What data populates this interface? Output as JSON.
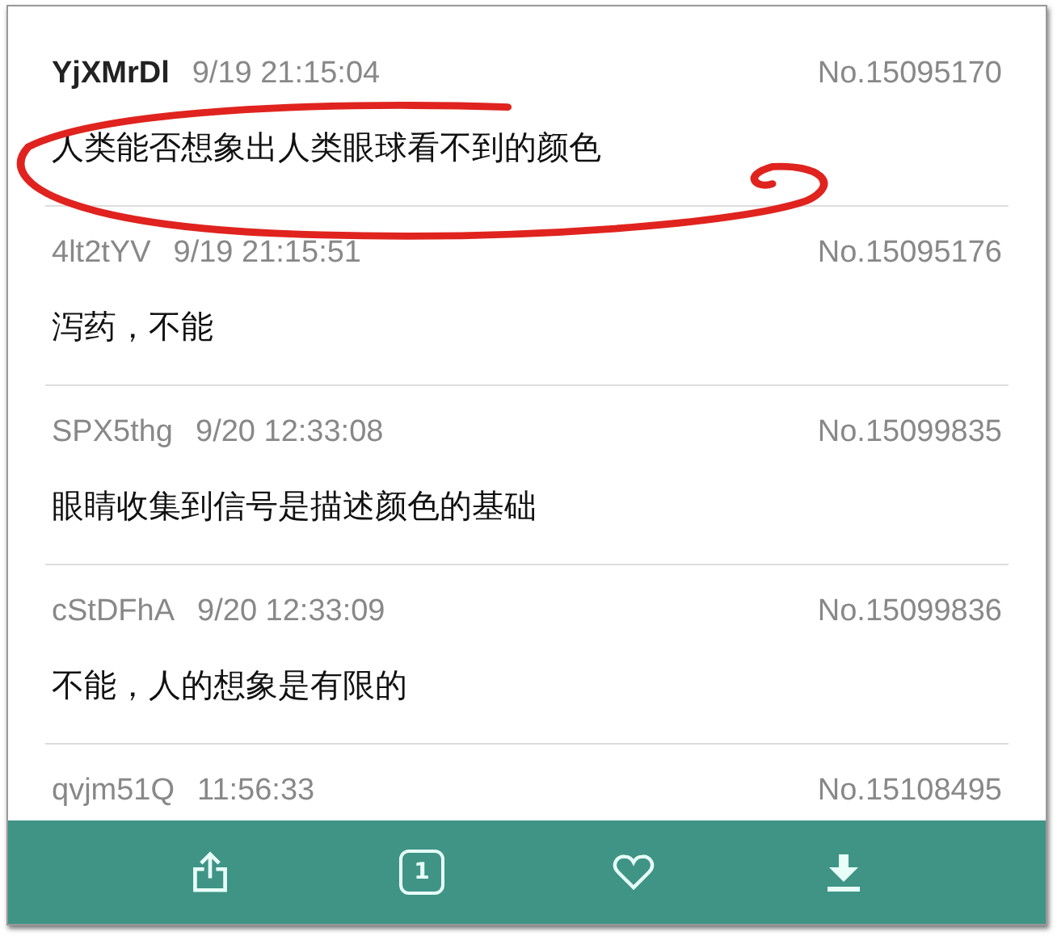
{
  "posts": [
    {
      "kind": "original",
      "user": "YjXMrDl",
      "time": "9/19 21:15:04",
      "number": "No.15095170",
      "text": "人类能否想象出人类眼球看不到的颜色",
      "circled": true
    },
    {
      "kind": "reply",
      "user": "4lt2tYV",
      "time": "9/19 21:15:51",
      "number": "No.15095176",
      "text": "泻药，不能",
      "circled": false
    },
    {
      "kind": "reply",
      "user": "SPX5thg",
      "time": "9/20 12:33:08",
      "number": "No.15099835",
      "text": "眼睛收集到信号是描述颜色的基础",
      "circled": false
    },
    {
      "kind": "reply",
      "user": "cStDFhA",
      "time": "9/20 12:33:09",
      "number": "No.15099836",
      "text": "不能，人的想象是有限的",
      "circled": false
    },
    {
      "kind": "reply",
      "user": "qvjm51Q",
      "time": "11:56:33",
      "number": "No.15108495",
      "circled": false
    }
  ],
  "toolbar": {
    "buttons": [
      {
        "kind": "share"
      },
      {
        "kind": "page",
        "count": "1"
      },
      {
        "kind": "like"
      },
      {
        "kind": "download"
      }
    ]
  }
}
